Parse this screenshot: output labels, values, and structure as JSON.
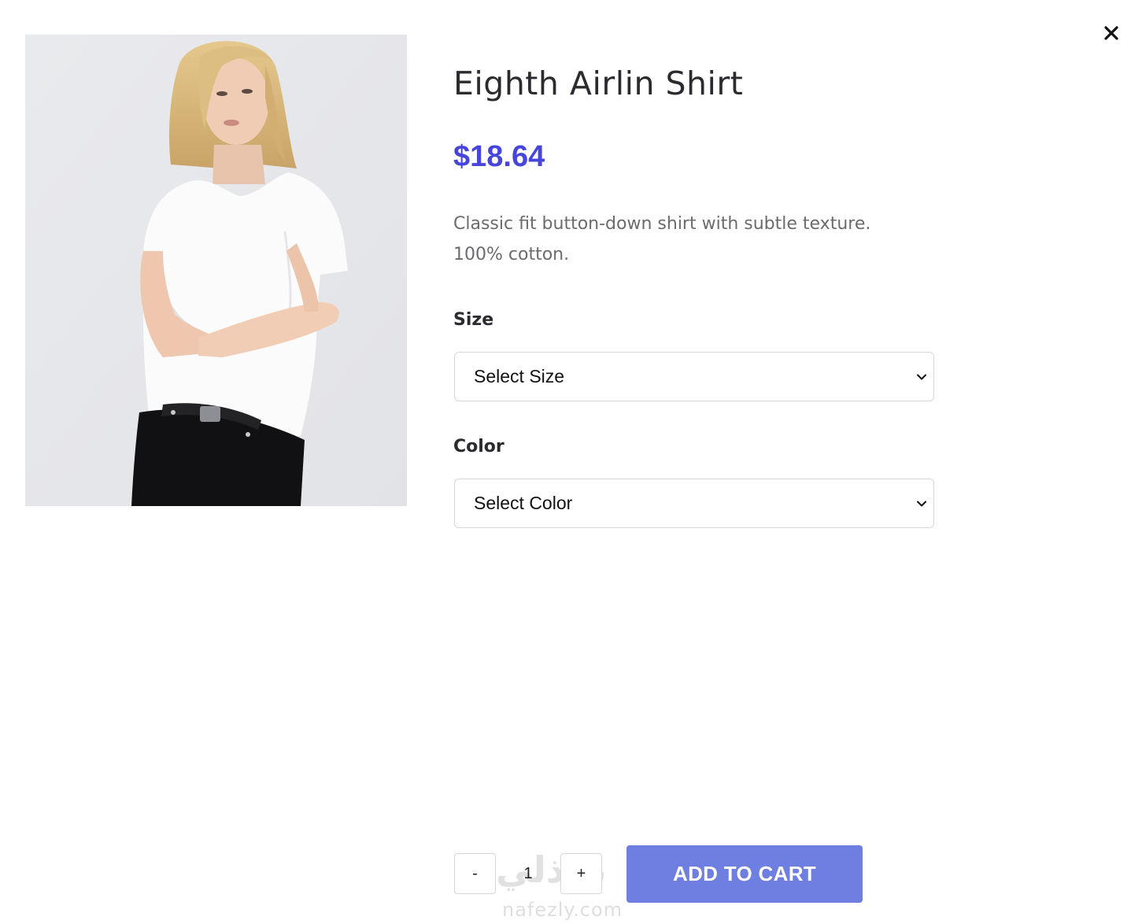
{
  "product": {
    "title": "Eighth Airlin Shirt",
    "price": "$18.64",
    "description": "Classic fit button-down shirt with subtle texture. 100% cotton.",
    "image_alt": "Woman wearing white t-shirt and black jeans"
  },
  "options": {
    "size": {
      "label": "Size",
      "selected": "Select Size"
    },
    "color": {
      "label": "Color",
      "selected": "Select Color"
    }
  },
  "cart": {
    "minus_label": "-",
    "quantity": "1",
    "plus_label": "+",
    "add_label": "ADD TO CART"
  },
  "watermark": {
    "arabic": "نفذلي",
    "latin": "nafezly.com"
  },
  "icons": {
    "close": "close-icon",
    "dropdown": "chevron-down-icon"
  },
  "colors": {
    "price": "#4746dc",
    "button": "#6f7ee1",
    "text": "#2b2b2f"
  }
}
